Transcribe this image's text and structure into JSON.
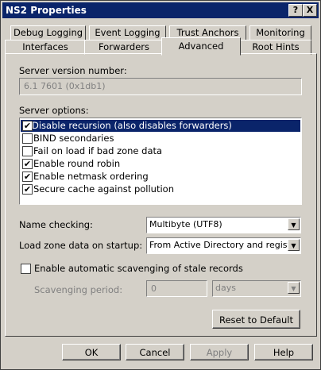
{
  "window": {
    "title": "NS2 Properties",
    "help_glyph": "?",
    "close_glyph": "X"
  },
  "tabs_row1": [
    "Debug Logging",
    "Event Logging",
    "Trust Anchors",
    "Monitoring"
  ],
  "tabs_row2": [
    "Interfaces",
    "Forwarders",
    "Advanced",
    "Root Hints"
  ],
  "active_tab": "Advanced",
  "advanced": {
    "version_label": "Server version number:",
    "version_value": "6.1 7601 (0x1db1)",
    "options_label": "Server options:",
    "options": [
      {
        "label": "Disable recursion (also disables forwarders)",
        "checked": true,
        "selected": true
      },
      {
        "label": "BIND secondaries",
        "checked": false,
        "selected": false
      },
      {
        "label": "Fail on load if bad zone data",
        "checked": false,
        "selected": false
      },
      {
        "label": "Enable round robin",
        "checked": true,
        "selected": false
      },
      {
        "label": "Enable netmask ordering",
        "checked": true,
        "selected": false
      },
      {
        "label": "Secure cache against pollution",
        "checked": true,
        "selected": false
      }
    ],
    "name_checking_label": "Name checking:",
    "name_checking_value": "Multibyte (UTF8)",
    "load_zone_label": "Load zone data on startup:",
    "load_zone_value": "From Active Directory and registry",
    "scavenging_label": "Enable automatic scavenging of stale records",
    "scavenging_checked": false,
    "scavenging_period_label": "Scavenging period:",
    "scavenging_period_value": "0",
    "scavenging_unit": "days",
    "reset_label": "Reset to Default"
  },
  "buttons": {
    "ok": "OK",
    "cancel": "Cancel",
    "apply": "Apply",
    "help": "Help"
  }
}
